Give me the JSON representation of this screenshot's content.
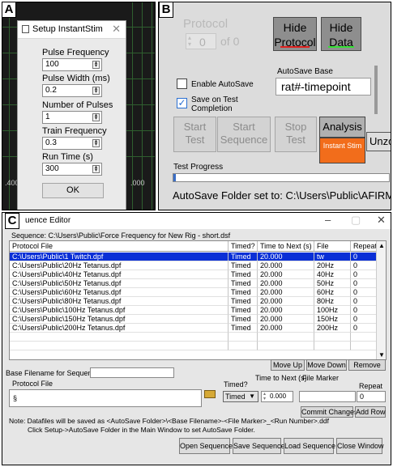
{
  "panel_labels": {
    "a": "A",
    "b": "B",
    "c": "C"
  },
  "panelA": {
    "dialog_title": "Setup InstantStim",
    "close_glyph": "✕",
    "fields": [
      {
        "label": "Pulse Frequency (Hz)",
        "value": "100"
      },
      {
        "label": "Pulse Width (ms)",
        "value": "0.2"
      },
      {
        "label": "Number of Pulses",
        "value": "1"
      },
      {
        "label": "Train Frequency (Hz)",
        "value": "0.3"
      },
      {
        "label": "Run Time (s)",
        "value": "300"
      }
    ],
    "ok_label": "OK",
    "axis_left": ".400",
    "axis_right": ".000"
  },
  "panelB": {
    "protocol_label": "Protocol",
    "protocol_value": "0",
    "protocol_of": "of 0",
    "hide_protocol": "Hide Protocol",
    "hide_data": "Hide Data",
    "autosave_base_label": "AutoSave Base",
    "autosave_base_value": "rat#-timepoint",
    "enable_autosave_label": "Enable AutoSave",
    "enable_autosave_checked": false,
    "save_on_completion_label": "Save on Test Completion",
    "save_on_completion_checked": true,
    "start_test": "Start Test",
    "start_sequence": "Start Sequence",
    "stop_test": "Stop Test",
    "analysis": "Analysis",
    "instant_stim": "Instant Stim",
    "unzoom": "Unzo",
    "test_progress_label": "Test Progress",
    "test_progress_fraction": 0.01,
    "autosave_message": "AutoSave Folder set to: C:\\Users\\Public\\AFIRM III",
    "colors": {
      "instant_stim": "#f26d1b",
      "hide_protocol_underline": "#e0201e",
      "hide_data_underline": "#35e035"
    }
  },
  "panelC": {
    "title": "uence Editor",
    "minimize": "–",
    "maximize": "▢",
    "close": "✕",
    "sequence_path": "Sequence:  C:\\Users\\Public\\Force Frequency for New Rig - short.dsf",
    "columns": [
      "Protocol File",
      "Timed?",
      "Time to Next (s)",
      "File Marker",
      "Repeat"
    ],
    "rows": [
      [
        "C:\\Users\\Public\\1 Twitch.dpf",
        "Timed",
        "20.000",
        "tw",
        "0"
      ],
      [
        "C:\\Users\\Public\\20Hz Tetanus.dpf",
        "Timed",
        "20.000",
        "20Hz",
        "0"
      ],
      [
        "C:\\Users\\Public\\40Hz Tetanus.dpf",
        "Timed",
        "20.000",
        "40Hz",
        "0"
      ],
      [
        "C:\\Users\\Public\\50Hz Tetanus.dpf",
        "Timed",
        "20.000",
        "50Hz",
        "0"
      ],
      [
        "C:\\Users\\Public\\60Hz Tetanus.dpf",
        "Timed",
        "20.000",
        "60Hz",
        "0"
      ],
      [
        "C:\\Users\\Public\\80Hz Tetanus.dpf",
        "Timed",
        "20.000",
        "80Hz",
        "0"
      ],
      [
        "C:\\Users\\Public\\100Hz Tetanus.dpf",
        "Timed",
        "20.000",
        "100Hz",
        "0"
      ],
      [
        "C:\\Users\\Public\\150Hz Tetanus.dpf",
        "Timed",
        "20.000",
        "150Hz",
        "0"
      ],
      [
        "C:\\Users\\Public\\200Hz Tetanus.dpf",
        "Timed",
        "20.000",
        "200Hz",
        "0"
      ]
    ],
    "selected_row": 0,
    "move_up": "Move Up",
    "move_down": "Move Down",
    "remove": "Remove",
    "base_filename_label": "Base Filename for Sequence",
    "protocol_file_label": "Protocol File",
    "protocol_file_icon": "§",
    "timed_label": "Timed?",
    "time_next_label": "Time to Next (s)",
    "file_marker_label": "File Marker",
    "repeat_label": "Repeat",
    "timed_value": "Timed",
    "time_next_value": "0.000",
    "repeat_value": "0",
    "commit_changes": "Commit Changes",
    "add_row": "Add Row",
    "note_line1": "Note: Datafiles will be saved as <AutoSave Folder>\\<Base Filename>-<File Marker>_<Run Number>.ddf",
    "note_line2": "Click Setup->AutoSave Folder in the Main Window to set AutoSave Folder.",
    "open_sequence": "Open Sequence",
    "save_sequence": "Save Sequence",
    "load_sequence": "Load Sequence",
    "close_window": "Close Window"
  }
}
